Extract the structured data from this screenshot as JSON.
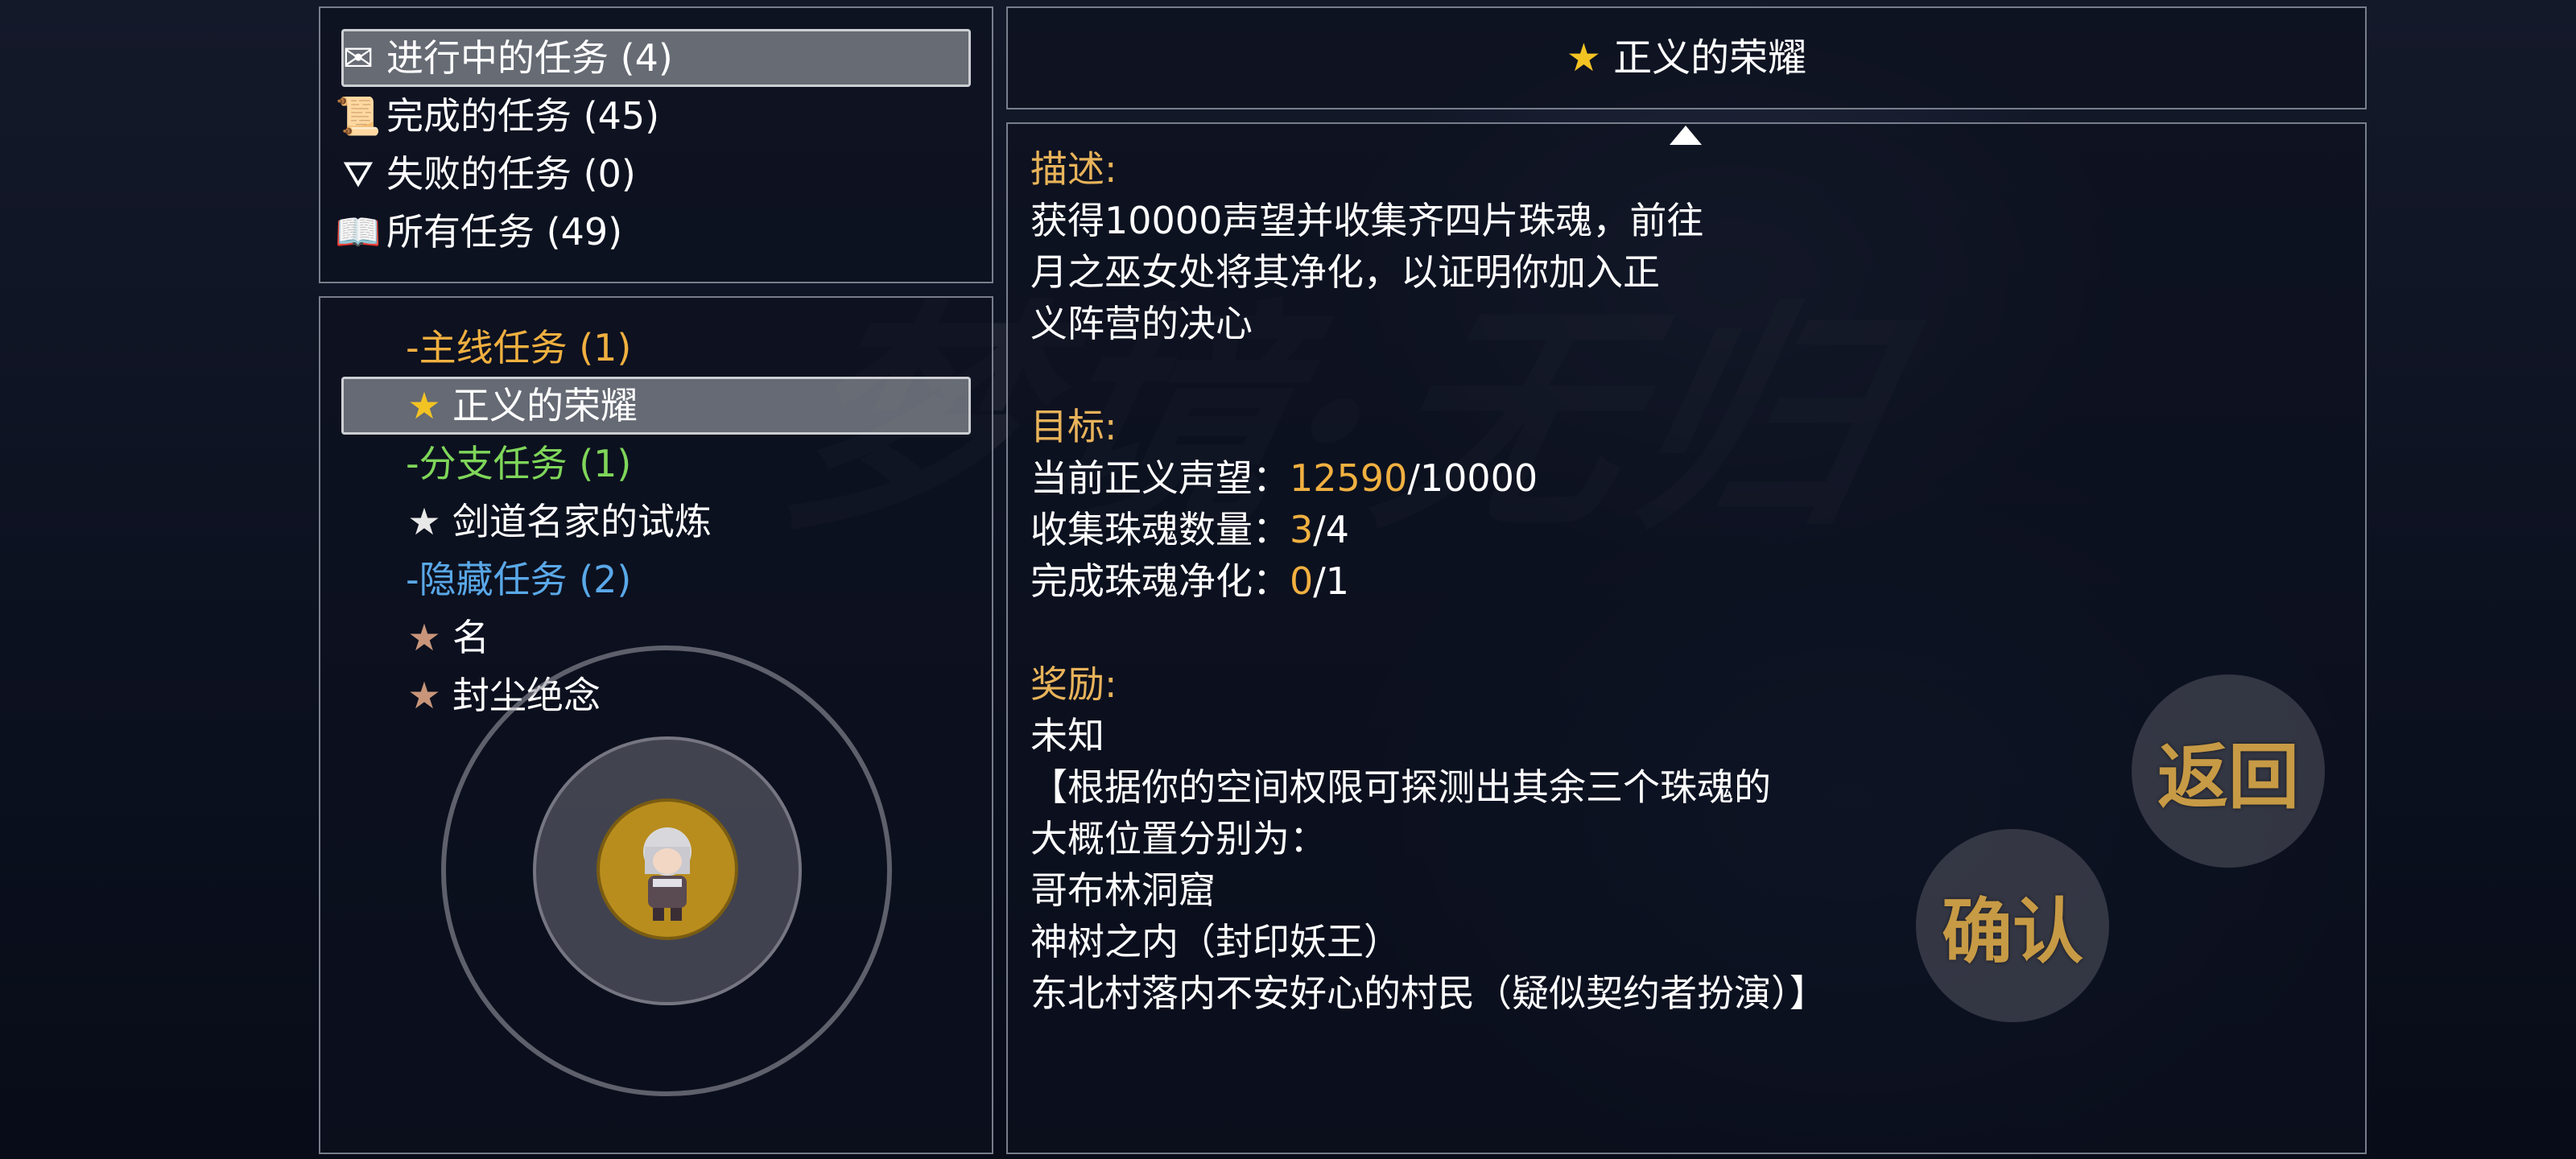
{
  "categories": [
    {
      "label": "进行中的任务 (4)",
      "icon": "envelope-icon"
    },
    {
      "label": "完成的任务 (45)",
      "icon": "scroll-icon"
    },
    {
      "label": "失败的任务 (0)",
      "icon": "broken-flag-icon"
    },
    {
      "label": "所有任务 (49)",
      "icon": "open-book-icon"
    }
  ],
  "quest_tree": {
    "main_header": "-主线任务 (1)",
    "main_item": "正义的荣耀",
    "side_header": "-分支任务 (1)",
    "side_item": "剑道名家的试炼",
    "hidden_header": "-隐藏任务 (2)",
    "hidden_items": [
      "名",
      "封尘绝念"
    ]
  },
  "detail": {
    "title": "正义的荣耀",
    "desc_label": "描述:",
    "desc_lines": [
      "获得10000声望并收集齐四片珠魂，前往",
      "月之巫女处将其净化，以证明你加入正",
      "义阵营的决心"
    ],
    "goal_label": "目标:",
    "goals": [
      {
        "name": "当前正义声望：",
        "current": "12590",
        "total": "/10000"
      },
      {
        "name": "收集珠魂数量：",
        "current": "3",
        "total": "/4"
      },
      {
        "name": "完成珠魂净化：",
        "current": "0",
        "total": "/1"
      }
    ],
    "reward_label": "奖励:",
    "reward_lines": [
      "未知",
      "【根据你的空间权限可探测出其余三个珠魂的",
      "大概位置分别为：",
      "哥布林洞窟",
      "神树之内（封印妖王）",
      "东北村落内不安好心的村民（疑似契约者扮演）】"
    ]
  },
  "buttons": {
    "back": "返回",
    "confirm": "确认"
  },
  "colors": {
    "main_quest": "#f0b040",
    "side_quest": "#7fd65a",
    "hidden_quest": "#5aa8e8",
    "label": "#e8b35a"
  }
}
